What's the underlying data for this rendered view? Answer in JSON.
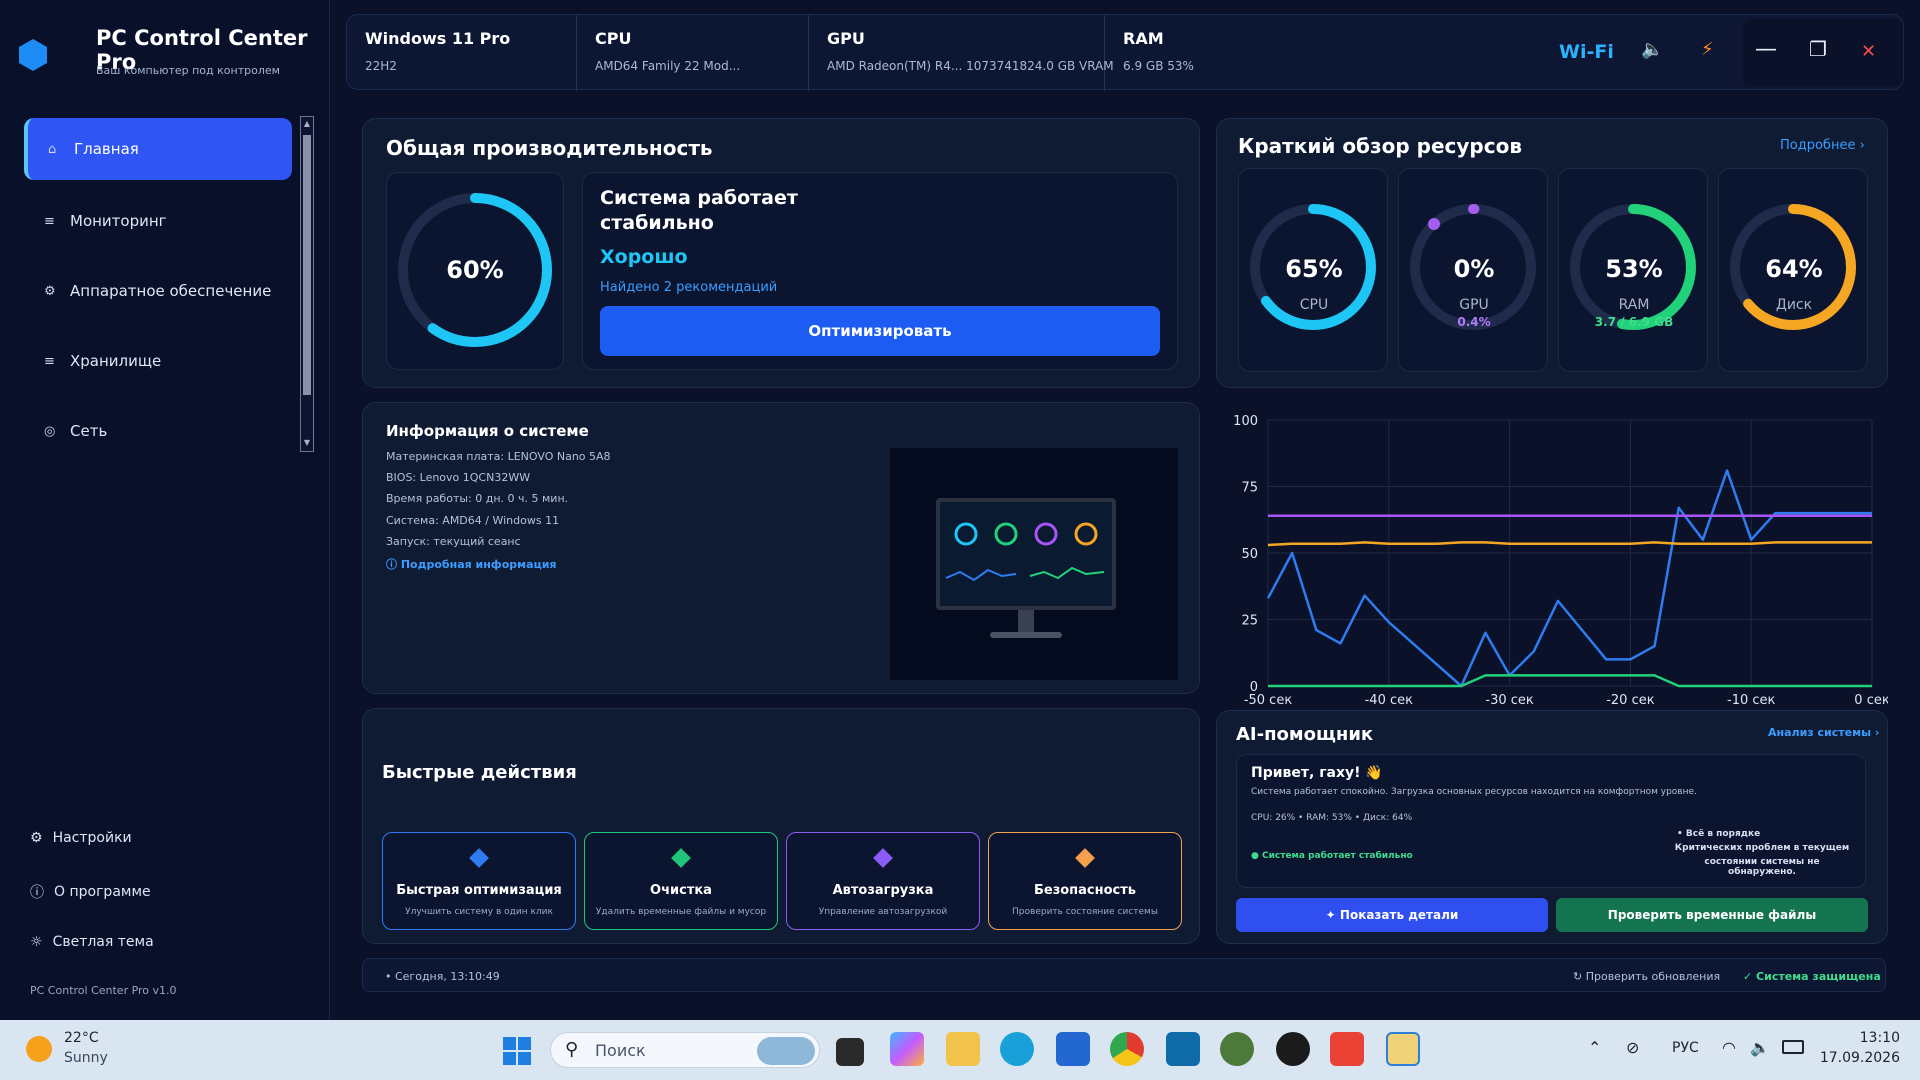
{
  "sidebar": {
    "app_title": "PC Control Center Pro",
    "app_subtitle": "Ваш компьютер под контролем",
    "items": [
      {
        "label": "Главная",
        "icon": "⌂"
      },
      {
        "label": "Мониторинг",
        "icon": "≡"
      },
      {
        "label": "Аппаратное обеспечение",
        "icon": "⚙"
      },
      {
        "label": "Хранилище",
        "icon": "≡"
      },
      {
        "label": "Сеть",
        "icon": "◎"
      }
    ],
    "bottom": [
      {
        "label": "Настройки",
        "icon": "⚙"
      },
      {
        "label": "О программе",
        "icon": "ⓘ"
      },
      {
        "label": "Светлая тема",
        "icon": "☼"
      }
    ],
    "version": "PC Control Center Pro v1.0"
  },
  "topbar": {
    "os": {
      "title": "Windows 11 Pro",
      "sub": "22H2"
    },
    "cpu": {
      "title": "CPU",
      "sub": "AMD64 Family 22 Mod..."
    },
    "gpu": {
      "title": "GPU",
      "sub": "AMD Radeon(TM) R4...   1073741824.0 GB VRAM"
    },
    "ram": {
      "title": "RAM",
      "sub": "6.9 GB   53%"
    },
    "wifi": "Wi-Fi",
    "volume_icon": "🔈",
    "power_icon": "⚡",
    "minimize": "—",
    "maximize": "❐",
    "close": "✕"
  },
  "performance": {
    "title": "Общая производительность",
    "value_text": "60%",
    "value": 60,
    "status_title": "Система работает стабильно",
    "status_rating": "Хорошо",
    "recommendations": "Найдено 2 рекомендаций",
    "optimize_label": "Оптимизировать"
  },
  "resources": {
    "title": "Краткий обзор ресурсов",
    "more_link": "Подробнее  ›",
    "items": [
      {
        "value_text": "65%",
        "label": "CPU",
        "extra": "",
        "value": 65,
        "color": "#1ec6f5"
      },
      {
        "value_text": "0%",
        "label": "GPU",
        "extra": "0.4%",
        "value": 0.4,
        "color": "#a55cf0"
      },
      {
        "value_text": "53%",
        "label": "RAM",
        "extra": "3.7 / 6.9 GB",
        "value": 53,
        "color": "#22d27a"
      },
      {
        "value_text": "64%",
        "label": "Диск",
        "extra": "",
        "value": 64,
        "color": "#f5a623"
      }
    ]
  },
  "sysinfo": {
    "title": "Информация о системе",
    "lines": [
      "Материнская плата:  LENOVO Nano 5A8",
      "BIOS:  Lenovo 1QCN32WW",
      "Время работы:  0 дн. 0 ч. 5 мин.",
      "Система:  AMD64 / Windows 11",
      "Запуск:  текущий сеанс"
    ],
    "details_link": "ⓘ  Подробная информация"
  },
  "chart_data": {
    "type": "line",
    "x": [
      -50,
      -48,
      -46,
      -44,
      -42,
      -40,
      -38,
      -36,
      -34,
      -32,
      -30,
      -28,
      -26,
      -24,
      -22,
      -20,
      -18,
      -16,
      -14,
      -12,
      -10,
      -8,
      -6,
      -4,
      -2,
      0
    ],
    "x_tick_labels": [
      "-50 сек",
      "-40 сек",
      "-30 сек",
      "-20 сек",
      "-10 сек",
      "0 сек"
    ],
    "y_ticks": [
      "100",
      "75",
      "50",
      "25",
      "0"
    ],
    "ylim": [
      0,
      100
    ],
    "xlim": [
      -50,
      0
    ],
    "grid": true,
    "series": [
      {
        "color": "#2f7cf0",
        "values": [
          33,
          50,
          21,
          16,
          34,
          24,
          16,
          8,
          0,
          20,
          4,
          13,
          32,
          21,
          10,
          10,
          15,
          67,
          55,
          81,
          55,
          65,
          65,
          65,
          65,
          65
        ]
      },
      {
        "color": "#a855f7",
        "values": [
          64,
          64,
          64,
          64,
          64,
          64,
          64,
          64,
          64,
          64,
          64,
          64,
          64,
          64,
          64,
          64,
          64,
          64,
          64,
          64,
          64,
          64,
          64,
          64,
          64,
          64
        ]
      },
      {
        "color": "#f5a623",
        "values": [
          53,
          53.5,
          53.5,
          53.5,
          54,
          53.5,
          53.5,
          53.5,
          54,
          54,
          53.5,
          53.5,
          53.5,
          53.5,
          53.5,
          53.5,
          54,
          53.5,
          53.5,
          53.5,
          53.5,
          54,
          54,
          54,
          54,
          54
        ]
      },
      {
        "color": "#22d27a",
        "values": [
          0,
          0,
          0,
          0,
          0,
          0,
          0,
          0,
          0,
          4,
          4,
          4,
          4,
          4,
          4,
          4,
          4,
          0,
          0,
          0,
          0,
          0,
          0,
          0,
          0,
          0
        ]
      }
    ]
  },
  "ai": {
    "title": "AI-помощник",
    "analysis_link": "Анализ системы  ›",
    "greeting": "Привет, гаху! 👋",
    "message": "Система работает спокойно. Загрузка основных ресурсов находится на комфортном уровне.",
    "stats": "CPU: 26%  •  RAM: 53%  •  Диск: 64%",
    "stable": "●  Система работает стабильно",
    "ok_title": "•  Всё в порядке",
    "ok_text_1": "Критических проблем в текущем",
    "ok_text_2": "состоянии системы не обнаружено.",
    "show_details": "✦  Показать детали",
    "check_temp": "Проверить временные файлы"
  },
  "quick_actions": {
    "title": "Быстрые действия",
    "items": [
      {
        "title": "Быстрая оптимизация",
        "sub": "Улучшить систему в один клик",
        "color": "#2f7cf0"
      },
      {
        "title": "Очистка",
        "sub": "Удалить временные файлы и мусор",
        "color": "#22c47a"
      },
      {
        "title": "Автозагрузка",
        "sub": "Управление автозагрузкой",
        "color": "#8b5cf6"
      },
      {
        "title": "Безопасность",
        "sub": "Проверить состояние системы",
        "color": "#f5a04d"
      }
    ]
  },
  "statusbar": {
    "time": "•  Сегодня, 13:10:49",
    "updates": "↻  Проверить обновления",
    "protected": "✓  Система защищена"
  },
  "taskbar": {
    "weather_temp": "22°C",
    "weather_desc": "Sunny",
    "search_placeholder": "Поиск",
    "lang": "РУС",
    "clock_time": "13:10",
    "clock_date": "17.09.2026"
  }
}
